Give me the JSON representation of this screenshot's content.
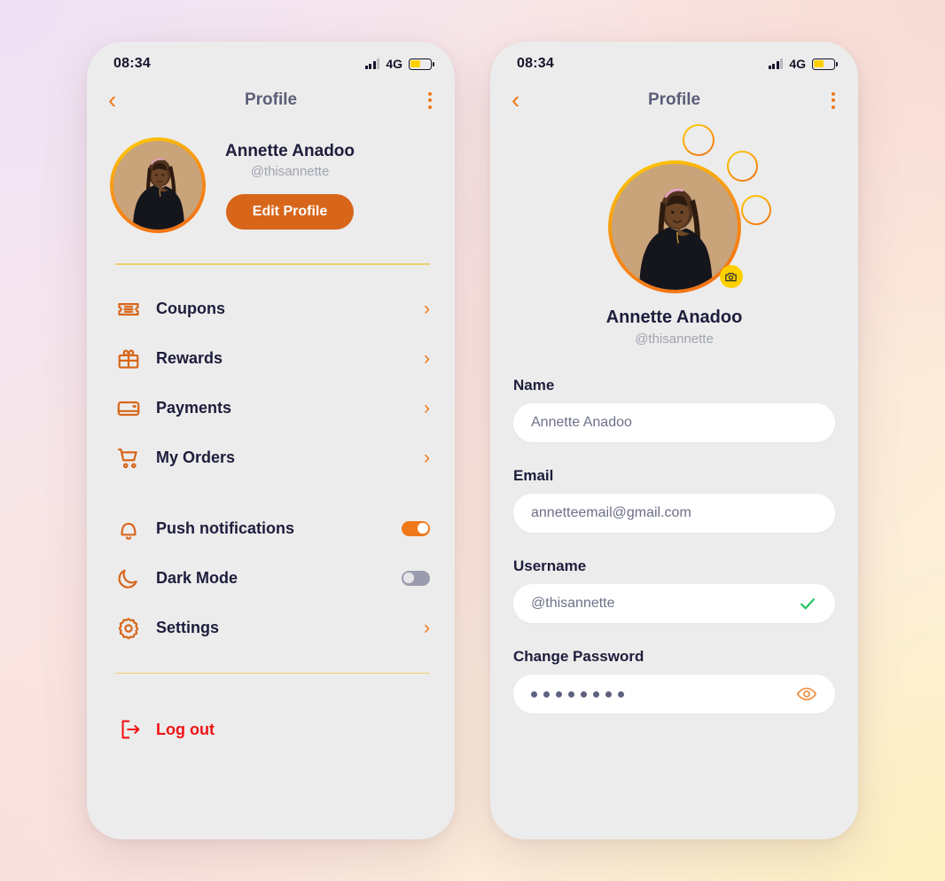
{
  "theme": {
    "accent_orange": "#f07818",
    "button_orange": "#d8661a",
    "accent_yellow": "#ffd000",
    "divider_gold": "#ecd06a",
    "text_dark": "#1d1d3c",
    "text_muted": "#a0a3b1",
    "logout_red": "#f01414",
    "check_green": "#22c55e",
    "phone_bg": "#ececec"
  },
  "status_bar": {
    "time": "08:34",
    "network": "4G",
    "signal_icon": "signal-bars-icon",
    "battery_icon": "battery-icon",
    "battery_level": 52
  },
  "nav": {
    "back_icon": "chevron-left-icon",
    "title": "Profile",
    "more_icon": "more-vertical-icon"
  },
  "profile_screen": {
    "avatar_icon": "user-avatar-photo",
    "name": "Annette Anadoo",
    "handle": "@thisannette",
    "edit_button": "Edit Profile",
    "menu": [
      {
        "label": "Coupons",
        "icon": "ticket-icon",
        "trailing": "chevron-right-icon"
      },
      {
        "label": "Rewards",
        "icon": "gift-icon",
        "trailing": "chevron-right-icon"
      },
      {
        "label": "Payments",
        "icon": "card-icon",
        "trailing": "chevron-right-icon"
      },
      {
        "label": "My Orders",
        "icon": "cart-icon",
        "trailing": "chevron-right-icon"
      },
      {
        "label": "Push notifications",
        "icon": "bell-icon",
        "trailing": "toggle-on"
      },
      {
        "label": "Dark Mode",
        "icon": "moon-icon",
        "trailing": "toggle-off"
      },
      {
        "label": "Settings",
        "icon": "gear-icon",
        "trailing": "chevron-right-icon"
      }
    ],
    "logout": {
      "label": "Log out",
      "icon": "logout-icon"
    }
  },
  "edit_screen": {
    "avatar_icon": "user-avatar-photo",
    "camera_badge_icon": "camera-icon",
    "name": "Annette Anadoo",
    "handle": "@thisannette",
    "fields": [
      {
        "label": "Name",
        "value": "Annette Anadoo",
        "placeholder": "Annette Anadoo",
        "trailing": "none"
      },
      {
        "label": "Email",
        "value": "annetteemail@gmail.com",
        "placeholder": "annetteemail@gmail.com",
        "trailing": "none"
      },
      {
        "label": "Username",
        "value": "@thisannette",
        "placeholder": "@thisannette",
        "trailing": "check-icon"
      },
      {
        "label": "Change Password",
        "value": "••••••••",
        "placeholder": "",
        "trailing": "eye-icon",
        "masked": true,
        "dot_count": 8
      }
    ]
  }
}
